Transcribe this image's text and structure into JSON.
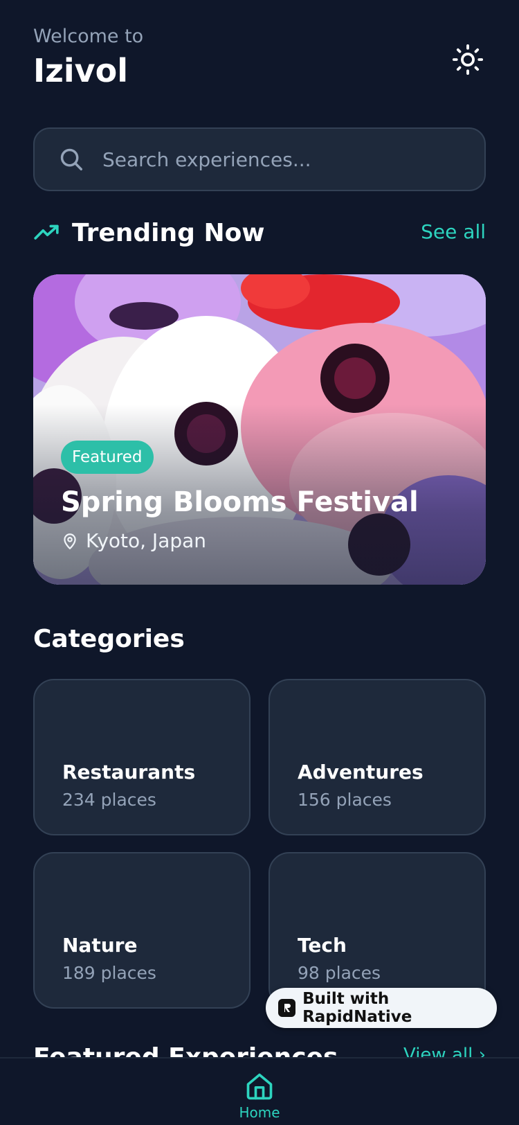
{
  "header": {
    "welcome": "Welcome to",
    "app_name": "Izivol",
    "theme_icon": "sun-icon"
  },
  "search": {
    "placeholder": "Search experiences...",
    "value": "",
    "icon": "search-icon"
  },
  "trending": {
    "icon": "trending-up-icon",
    "title": "Trending Now",
    "see_all": "See all",
    "card": {
      "badge": "Featured",
      "title": "Spring Blooms Festival",
      "location": "Kyoto, Japan",
      "location_icon": "map-pin-icon"
    }
  },
  "categories": {
    "title": "Categories",
    "items": [
      {
        "name": "Restaurants",
        "count": "234 places"
      },
      {
        "name": "Adventures",
        "count": "156 places"
      },
      {
        "name": "Nature",
        "count": "189 places"
      },
      {
        "name": "Tech",
        "count": "98 places"
      }
    ]
  },
  "featured_section": {
    "title": "Featured Experiences",
    "link": "View all ›"
  },
  "tab_bar": {
    "home_label": "Home",
    "home_icon": "home-icon"
  },
  "built_with": {
    "label": "Built with RapidNative"
  },
  "colors": {
    "background": "#0f172a",
    "card": "#1e293b",
    "accent": "#2dd4bf",
    "muted": "#94a3b8"
  }
}
